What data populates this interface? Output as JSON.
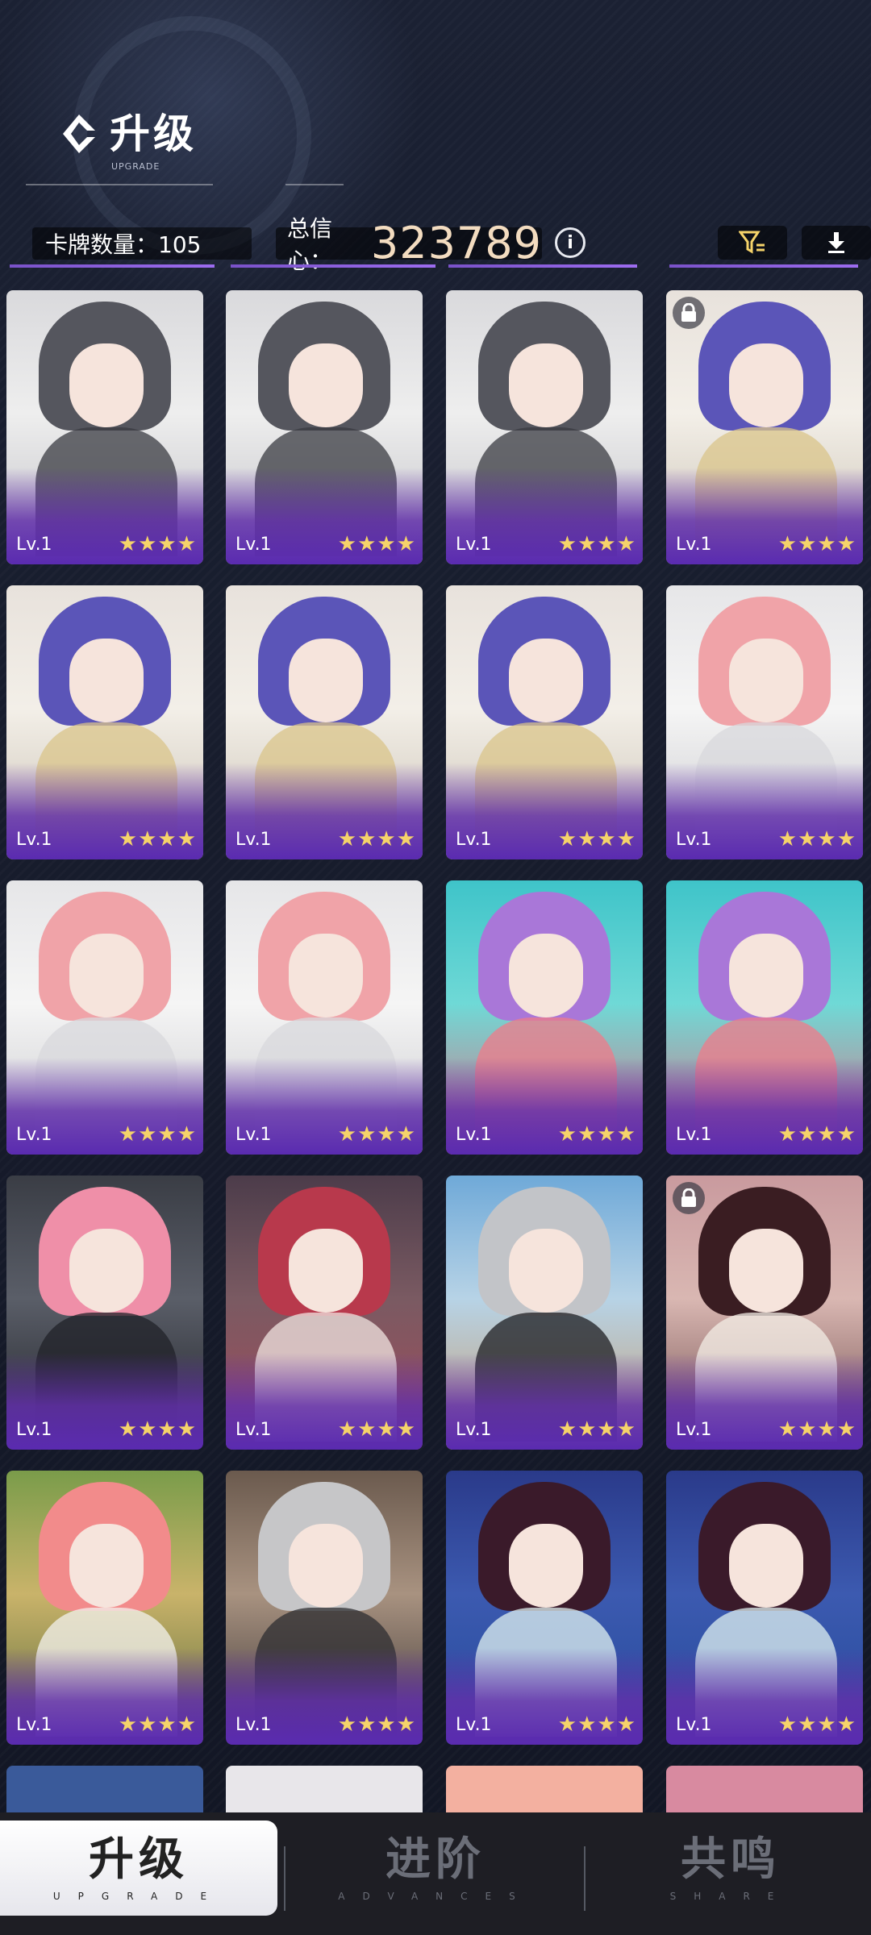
{
  "header": {
    "title": "升级",
    "subtitle": "UPGRADE",
    "card_count": "卡牌数量：105",
    "confidence_label": "总信心：",
    "confidence_value": "323789"
  },
  "icons": {
    "back": "diamond-arrow-icon",
    "info": "info-icon",
    "filter": "filter-icon",
    "download": "download-icon",
    "lock": "lock-icon"
  },
  "cards": [
    {
      "level": "Lv.1",
      "stars": "★★★★",
      "theme": "gray",
      "locked": false
    },
    {
      "level": "Lv.1",
      "stars": "★★★★",
      "theme": "gray",
      "locked": false
    },
    {
      "level": "Lv.1",
      "stars": "★★★★",
      "theme": "gray",
      "locked": false
    },
    {
      "level": "Lv.1",
      "stars": "★★★★",
      "theme": "violet",
      "locked": true
    },
    {
      "level": "Lv.1",
      "stars": "★★★★",
      "theme": "violet",
      "locked": false
    },
    {
      "level": "Lv.1",
      "stars": "★★★★",
      "theme": "violet",
      "locked": false
    },
    {
      "level": "Lv.1",
      "stars": "★★★★",
      "theme": "violet",
      "locked": false
    },
    {
      "level": "Lv.1",
      "stars": "★★★★",
      "theme": "pink",
      "locked": false
    },
    {
      "level": "Lv.1",
      "stars": "★★★★",
      "theme": "pink",
      "locked": false
    },
    {
      "level": "Lv.1",
      "stars": "★★★★",
      "theme": "pink",
      "locked": false
    },
    {
      "level": "Lv.1",
      "stars": "★★★★",
      "theme": "pool",
      "locked": false
    },
    {
      "level": "Lv.1",
      "stars": "★★★★",
      "theme": "pool",
      "locked": false
    },
    {
      "level": "Lv.1",
      "stars": "★★★★",
      "theme": "gym",
      "locked": false
    },
    {
      "level": "Lv.1",
      "stars": "★★★★",
      "theme": "guitar",
      "locked": false
    },
    {
      "level": "Lv.1",
      "stars": "★★★★",
      "theme": "beach",
      "locked": false
    },
    {
      "level": "Lv.1",
      "stars": "★★★★",
      "theme": "dusk",
      "locked": true
    },
    {
      "level": "Lv.1",
      "stars": "★★★★",
      "theme": "park",
      "locked": false
    },
    {
      "level": "Lv.1",
      "stars": "★★★★",
      "theme": "office",
      "locked": false
    },
    {
      "level": "Lv.1",
      "stars": "★★★★",
      "theme": "fireworks",
      "locked": false
    },
    {
      "level": "Lv.1",
      "stars": "★★★★",
      "theme": "fireworks",
      "locked": false
    }
  ],
  "bottom_nav": {
    "tabs": [
      {
        "label": "升级",
        "sub": "UPGRADE"
      },
      {
        "label": "进阶",
        "sub": "ADVANCES"
      },
      {
        "label": "共鸣",
        "sub": "SHARE"
      }
    ]
  },
  "colors": {
    "accent": "#7a52c9",
    "star": "#f5d36a",
    "confidence": "#f3dcc0"
  }
}
